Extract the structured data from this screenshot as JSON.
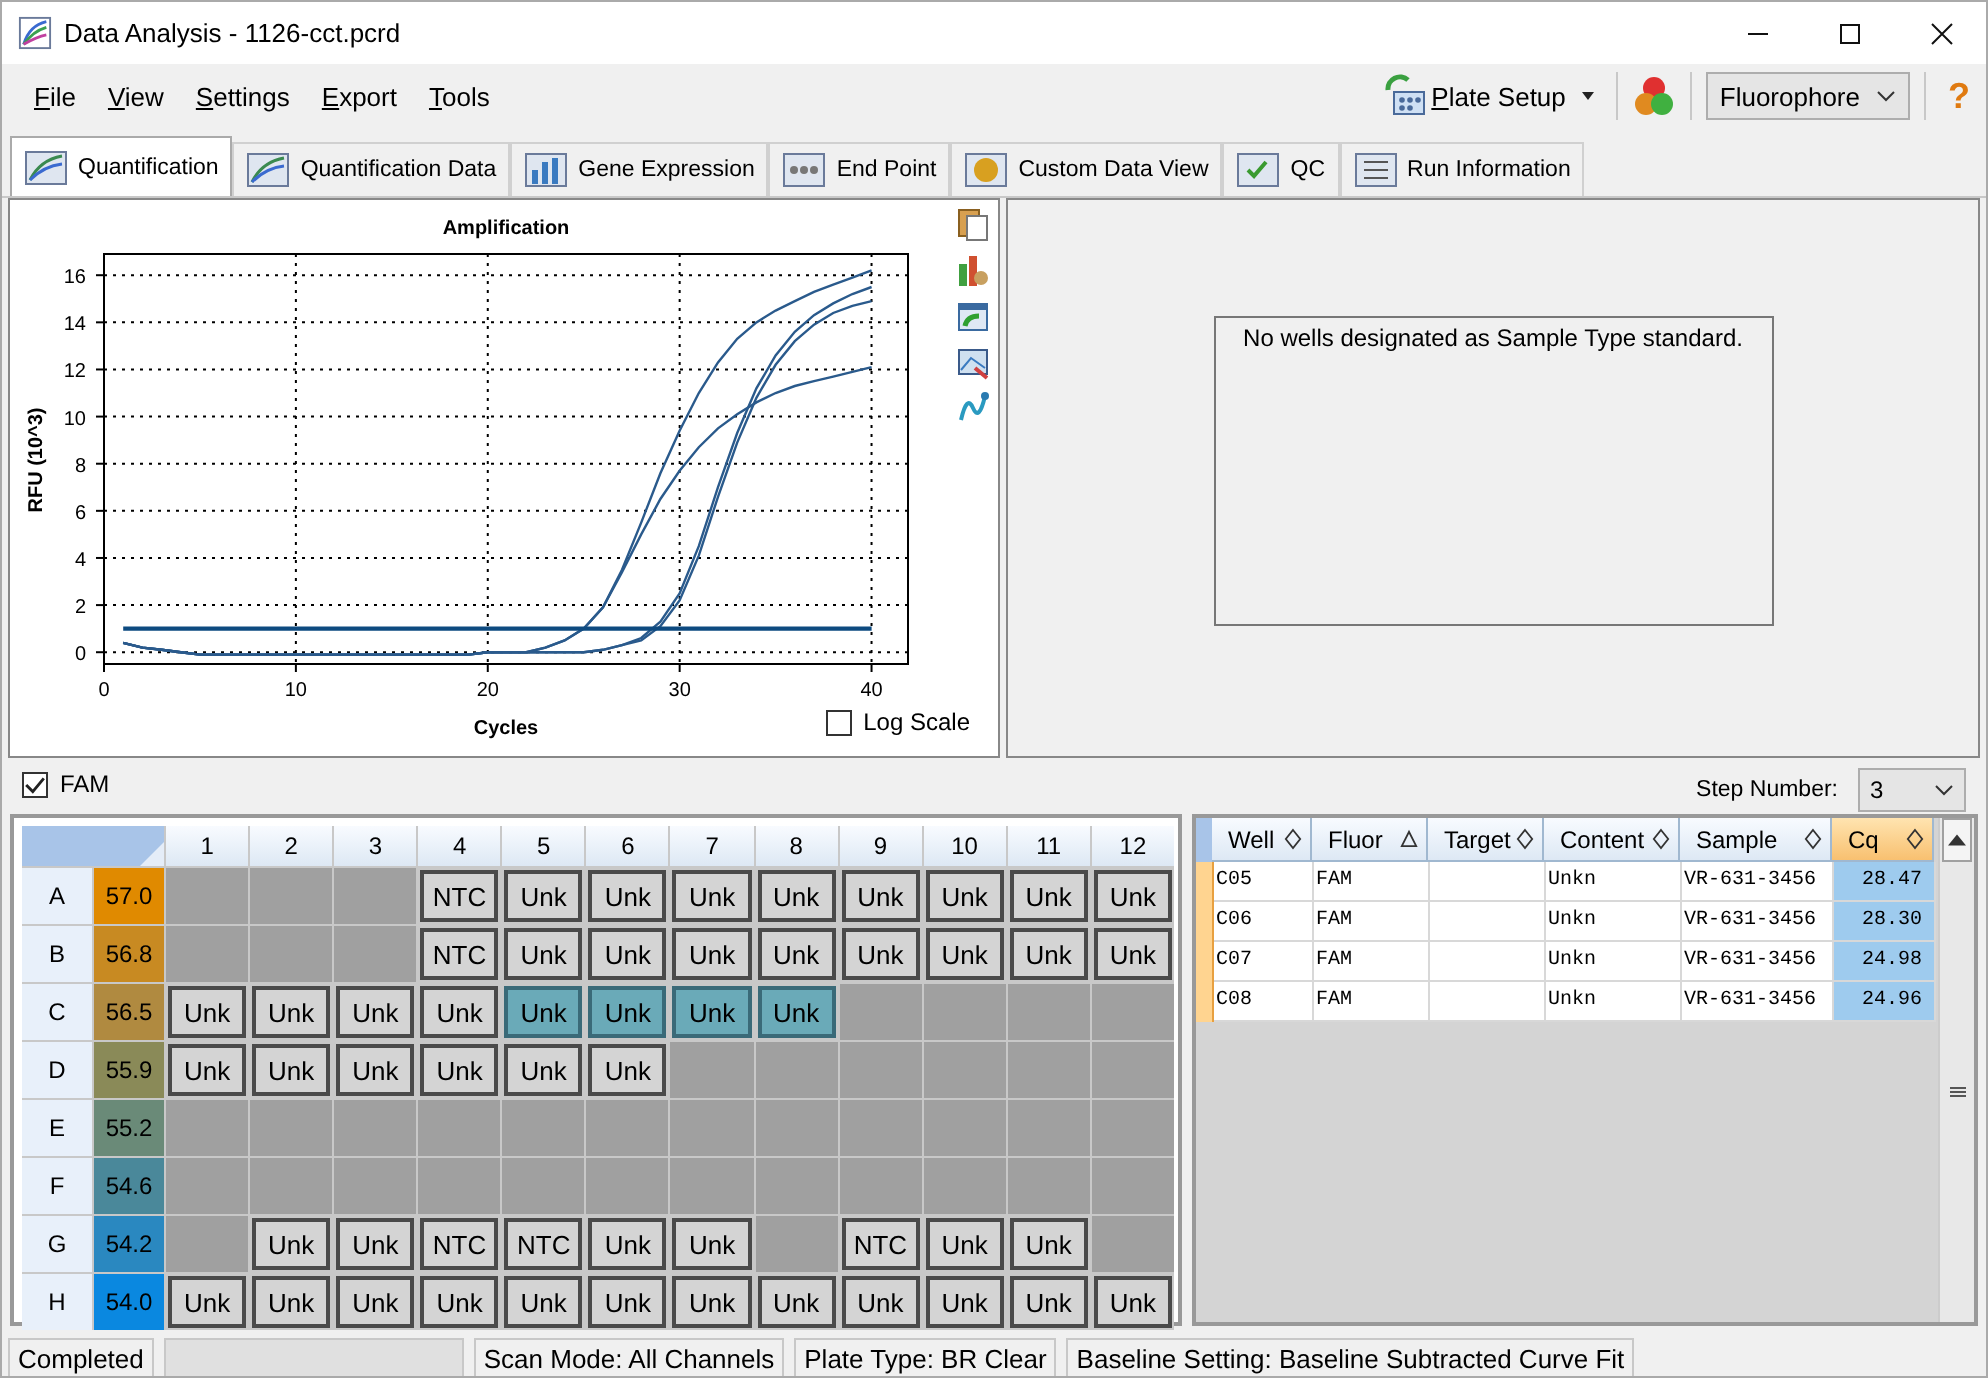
{
  "window": {
    "title": "Data Analysis - 1126-cct.pcrd"
  },
  "menu": [
    "File",
    "View",
    "Settings",
    "Export",
    "Tools"
  ],
  "toolbar": {
    "plate_setup": "Plate Setup",
    "fluorophore": "Fluorophore",
    "help": "?"
  },
  "tabs": [
    {
      "label": "Quantification",
      "selected": true
    },
    {
      "label": "Quantification Data",
      "selected": false
    },
    {
      "label": "Gene Expression",
      "selected": false
    },
    {
      "label": "End Point",
      "selected": false
    },
    {
      "label": "Custom Data View",
      "selected": false
    },
    {
      "label": "QC",
      "selected": false
    },
    {
      "label": "Run Information",
      "selected": false
    }
  ],
  "amplification": {
    "log_scale": {
      "label": "Log Scale",
      "checked": false
    },
    "chart_data": {
      "type": "line",
      "title": "Amplification",
      "xlabel": "Cycles",
      "ylabel": "RFU (10^3)",
      "x": [
        1,
        2,
        3,
        4,
        5,
        6,
        7,
        8,
        9,
        10,
        11,
        12,
        13,
        14,
        15,
        16,
        17,
        18,
        19,
        20,
        21,
        22,
        23,
        24,
        25,
        26,
        27,
        28,
        29,
        30,
        31,
        32,
        33,
        34,
        35,
        36,
        37,
        38,
        39,
        40
      ],
      "series": [
        {
          "color": "#2a5a8c",
          "values": [
            0.4,
            0.2,
            0.1,
            0,
            -0.1,
            -0.1,
            -0.1,
            -0.1,
            -0.1,
            -0.1,
            -0.1,
            -0.1,
            -0.1,
            -0.1,
            -0.1,
            -0.1,
            -0.1,
            -0.1,
            -0.1,
            0,
            0,
            0,
            0,
            0,
            0,
            0.1,
            0.3,
            0.6,
            1.3,
            2.5,
            4.5,
            7.0,
            9.3,
            11.2,
            12.6,
            13.6,
            14.3,
            14.8,
            15.2,
            15.5
          ]
        },
        {
          "color": "#2a5a8c",
          "values": [
            0.4,
            0.2,
            0.1,
            0,
            -0.1,
            -0.1,
            -0.1,
            -0.1,
            -0.1,
            -0.1,
            -0.1,
            -0.1,
            -0.1,
            -0.1,
            -0.1,
            -0.1,
            -0.1,
            -0.1,
            -0.1,
            0,
            0,
            0,
            0,
            0,
            0,
            0.1,
            0.3,
            0.5,
            1.1,
            2.2,
            4.1,
            6.6,
            8.9,
            10.8,
            12.2,
            13.2,
            13.9,
            14.4,
            14.7,
            14.9
          ]
        },
        {
          "color": "#2a5a8c",
          "values": [
            0.4,
            0.2,
            0.1,
            0,
            -0.1,
            -0.1,
            -0.1,
            -0.1,
            -0.1,
            -0.1,
            -0.1,
            -0.1,
            -0.1,
            -0.1,
            -0.1,
            -0.1,
            -0.1,
            -0.1,
            -0.1,
            0,
            0,
            0,
            0.2,
            0.5,
            1.0,
            1.9,
            3.5,
            5.5,
            7.6,
            9.4,
            11.0,
            12.3,
            13.3,
            14.0,
            14.5,
            14.9,
            15.3,
            15.6,
            15.9,
            16.2
          ]
        },
        {
          "color": "#2a5a8c",
          "values": [
            0.4,
            0.2,
            0.1,
            0,
            -0.1,
            -0.1,
            -0.1,
            -0.1,
            -0.1,
            -0.1,
            -0.1,
            -0.1,
            -0.1,
            -0.1,
            -0.1,
            -0.1,
            -0.1,
            -0.1,
            -0.1,
            0,
            0,
            0,
            0.2,
            0.5,
            1.0,
            1.9,
            3.4,
            5.0,
            6.5,
            7.7,
            8.7,
            9.5,
            10.1,
            10.6,
            11.0,
            11.3,
            11.5,
            11.7,
            11.9,
            12.1
          ]
        },
        {
          "color": "#0d4a80",
          "values": [
            1,
            1,
            1,
            1,
            1,
            1,
            1,
            1,
            1,
            1,
            1,
            1,
            1,
            1,
            1,
            1,
            1,
            1,
            1,
            1,
            1,
            1,
            1,
            1,
            1,
            1,
            1,
            1,
            1,
            1,
            1,
            1,
            1,
            1,
            1,
            1,
            1,
            1,
            1,
            1
          ]
        }
      ],
      "grid": true,
      "xlim": [
        0,
        41.9
      ],
      "ylim": [
        -0.5,
        16.9
      ],
      "xticks": [
        0,
        10,
        20,
        30,
        40
      ],
      "yticks": [
        0,
        2,
        4,
        6,
        8,
        10,
        12,
        14,
        16
      ]
    }
  },
  "standard_curve": {
    "message": "No wells designated as Sample Type standard."
  },
  "fluor_filter": {
    "label": "FAM",
    "checked": true
  },
  "step_number": {
    "label": "Step Number:",
    "value": "3"
  },
  "plate": {
    "columns": [
      "1",
      "2",
      "3",
      "4",
      "5",
      "6",
      "7",
      "8",
      "9",
      "10",
      "11",
      "12"
    ],
    "rows": [
      {
        "label": "A",
        "temperature": "57.0",
        "color": "#e08a00",
        "wells": [
          {
            "kind": "empty",
            "selected": false
          },
          {
            "kind": "empty",
            "selected": false
          },
          {
            "kind": "empty",
            "selected": false
          },
          {
            "kind": "sample",
            "label": "NTC",
            "selected": false
          },
          {
            "kind": "sample",
            "label": "Unk",
            "selected": false
          },
          {
            "kind": "sample",
            "label": "Unk",
            "selected": false
          },
          {
            "kind": "sample",
            "label": "Unk",
            "selected": false
          },
          {
            "kind": "sample",
            "label": "Unk",
            "selected": false
          },
          {
            "kind": "sample",
            "label": "Unk",
            "selected": false
          },
          {
            "kind": "sample",
            "label": "Unk",
            "selected": false
          },
          {
            "kind": "sample",
            "label": "Unk",
            "selected": false
          },
          {
            "kind": "sample",
            "label": "Unk",
            "selected": false
          }
        ]
      },
      {
        "label": "B",
        "temperature": "56.8",
        "color": "#c88a22",
        "wells": [
          {
            "kind": "empty",
            "selected": false
          },
          {
            "kind": "empty",
            "selected": false
          },
          {
            "kind": "empty",
            "selected": false
          },
          {
            "kind": "sample",
            "label": "NTC",
            "selected": false
          },
          {
            "kind": "sample",
            "label": "Unk",
            "selected": false
          },
          {
            "kind": "sample",
            "label": "Unk",
            "selected": false
          },
          {
            "kind": "sample",
            "label": "Unk",
            "selected": false
          },
          {
            "kind": "sample",
            "label": "Unk",
            "selected": false
          },
          {
            "kind": "sample",
            "label": "Unk",
            "selected": false
          },
          {
            "kind": "sample",
            "label": "Unk",
            "selected": false
          },
          {
            "kind": "sample",
            "label": "Unk",
            "selected": false
          },
          {
            "kind": "sample",
            "label": "Unk",
            "selected": false
          }
        ]
      },
      {
        "label": "C",
        "temperature": "56.5",
        "color": "#b08a40",
        "wells": [
          {
            "kind": "sample",
            "label": "Unk",
            "selected": false
          },
          {
            "kind": "sample",
            "label": "Unk",
            "selected": false
          },
          {
            "kind": "sample",
            "label": "Unk",
            "selected": false
          },
          {
            "kind": "sample",
            "label": "Unk",
            "selected": false
          },
          {
            "kind": "sample",
            "label": "Unk",
            "selected": true
          },
          {
            "kind": "sample",
            "label": "Unk",
            "selected": true
          },
          {
            "kind": "sample",
            "label": "Unk",
            "selected": true
          },
          {
            "kind": "sample",
            "label": "Unk",
            "selected": true
          },
          {
            "kind": "empty",
            "selected": false
          },
          {
            "kind": "empty",
            "selected": false
          },
          {
            "kind": "empty",
            "selected": false
          },
          {
            "kind": "empty",
            "selected": false
          }
        ]
      },
      {
        "label": "D",
        "temperature": "55.9",
        "color": "#8a8a58",
        "wells": [
          {
            "kind": "sample",
            "label": "Unk",
            "selected": false
          },
          {
            "kind": "sample",
            "label": "Unk",
            "selected": false
          },
          {
            "kind": "sample",
            "label": "Unk",
            "selected": false
          },
          {
            "kind": "sample",
            "label": "Unk",
            "selected": false
          },
          {
            "kind": "sample",
            "label": "Unk",
            "selected": false
          },
          {
            "kind": "sample",
            "label": "Unk",
            "selected": false
          },
          {
            "kind": "empty",
            "selected": false
          },
          {
            "kind": "empty",
            "selected": false
          },
          {
            "kind": "empty",
            "selected": false
          },
          {
            "kind": "empty",
            "selected": false
          },
          {
            "kind": "empty",
            "selected": false
          },
          {
            "kind": "empty",
            "selected": false
          }
        ]
      },
      {
        "label": "E",
        "temperature": "55.2",
        "color": "#6a8a78",
        "wells": [
          {
            "kind": "empty",
            "selected": false
          },
          {
            "kind": "empty",
            "selected": false
          },
          {
            "kind": "empty",
            "selected": false
          },
          {
            "kind": "empty",
            "selected": false
          },
          {
            "kind": "empty",
            "selected": false
          },
          {
            "kind": "empty",
            "selected": false
          },
          {
            "kind": "empty",
            "selected": false
          },
          {
            "kind": "empty",
            "selected": false
          },
          {
            "kind": "empty",
            "selected": false
          },
          {
            "kind": "empty",
            "selected": false
          },
          {
            "kind": "empty",
            "selected": false
          },
          {
            "kind": "empty",
            "selected": false
          }
        ]
      },
      {
        "label": "F",
        "temperature": "54.6",
        "color": "#4a889a",
        "wells": [
          {
            "kind": "empty",
            "selected": false
          },
          {
            "kind": "empty",
            "selected": false
          },
          {
            "kind": "empty",
            "selected": false
          },
          {
            "kind": "empty",
            "selected": false
          },
          {
            "kind": "empty",
            "selected": false
          },
          {
            "kind": "empty",
            "selected": false
          },
          {
            "kind": "empty",
            "selected": false
          },
          {
            "kind": "empty",
            "selected": false
          },
          {
            "kind": "empty",
            "selected": false
          },
          {
            "kind": "empty",
            "selected": false
          },
          {
            "kind": "empty",
            "selected": false
          },
          {
            "kind": "empty",
            "selected": false
          }
        ]
      },
      {
        "label": "G",
        "temperature": "54.2",
        "color": "#2a88c0",
        "wells": [
          {
            "kind": "empty",
            "selected": false
          },
          {
            "kind": "sample",
            "label": "Unk",
            "selected": false
          },
          {
            "kind": "sample",
            "label": "Unk",
            "selected": false
          },
          {
            "kind": "sample",
            "label": "NTC",
            "selected": false
          },
          {
            "kind": "sample",
            "label": "NTC",
            "selected": false
          },
          {
            "kind": "sample",
            "label": "Unk",
            "selected": false
          },
          {
            "kind": "sample",
            "label": "Unk",
            "selected": false
          },
          {
            "kind": "empty",
            "selected": false
          },
          {
            "kind": "sample",
            "label": "NTC",
            "selected": false
          },
          {
            "kind": "sample",
            "label": "Unk",
            "selected": false
          },
          {
            "kind": "sample",
            "label": "Unk",
            "selected": false
          },
          {
            "kind": "empty",
            "selected": false
          }
        ]
      },
      {
        "label": "H",
        "temperature": "54.0",
        "color": "#0a88e0",
        "wells": [
          {
            "kind": "sample",
            "label": "Unk",
            "selected": false
          },
          {
            "kind": "sample",
            "label": "Unk",
            "selected": false
          },
          {
            "kind": "sample",
            "label": "Unk",
            "selected": false
          },
          {
            "kind": "sample",
            "label": "Unk",
            "selected": false
          },
          {
            "kind": "sample",
            "label": "Unk",
            "selected": false
          },
          {
            "kind": "sample",
            "label": "Unk",
            "selected": false
          },
          {
            "kind": "sample",
            "label": "Unk",
            "selected": false
          },
          {
            "kind": "sample",
            "label": "Unk",
            "selected": false
          },
          {
            "kind": "sample",
            "label": "Unk",
            "selected": false
          },
          {
            "kind": "sample",
            "label": "Unk",
            "selected": false
          },
          {
            "kind": "sample",
            "label": "Unk",
            "selected": false
          },
          {
            "kind": "sample",
            "label": "Unk",
            "selected": false
          }
        ]
      }
    ]
  },
  "results": {
    "columns": [
      {
        "label": "Well",
        "sorted": false,
        "selected": false
      },
      {
        "label": "Fluor",
        "sorted": true,
        "selected": false
      },
      {
        "label": "Target",
        "sorted": false,
        "selected": false
      },
      {
        "label": "Content",
        "sorted": false,
        "selected": false
      },
      {
        "label": "Sample",
        "sorted": false,
        "selected": false
      },
      {
        "label": "Cq",
        "sorted": false,
        "selected": true
      }
    ],
    "rows": [
      {
        "cells": [
          "C05",
          "FAM",
          "",
          "Unkn",
          "VR-631-3456",
          "28.47"
        ]
      },
      {
        "cells": [
          "C06",
          "FAM",
          "",
          "Unkn",
          "VR-631-3456",
          "28.30"
        ]
      },
      {
        "cells": [
          "C07",
          "FAM",
          "",
          "Unkn",
          "VR-631-3456",
          "24.98"
        ]
      },
      {
        "cells": [
          "C08",
          "FAM",
          "",
          "Unkn",
          "VR-631-3456",
          "24.96"
        ]
      }
    ]
  },
  "status_bar": {
    "state": "Completed",
    "scan_mode": "Scan Mode: All Channels",
    "plate_type": "Plate Type: BR Clear",
    "baseline": "Baseline Setting: Baseline Subtracted Curve Fit"
  }
}
